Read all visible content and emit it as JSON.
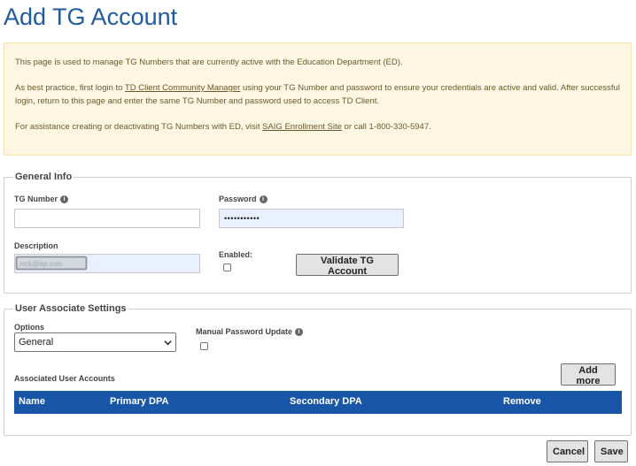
{
  "page": {
    "title": "Add TG Account"
  },
  "notice": {
    "p1": "This page is used to manage TG Numbers that are currently active with the Education Department (ED).",
    "p2_pre": "As best practice, first login to ",
    "p2_link": "TD Client Community Manager",
    "p2_post": " using your TG Number and password to ensure your credentials are active and valid. After successful login, return to this page and enter the same TG Number and password used to access TD Client.",
    "p3_pre": "For assistance creating or deactivating TG Numbers with ED, visit ",
    "p3_link": "SAIG Enrollment Site",
    "p3_post": " or call 1-800-330-5947."
  },
  "general": {
    "legend": "General Info",
    "tg_number_label": "TG Number",
    "tg_number_value": "",
    "password_label": "Password",
    "password_value": "•••••••••••",
    "description_label": "Description",
    "description_value": "nick@ep.com",
    "enabled_label": "Enabled:",
    "validate_label": "Validate TG Account"
  },
  "user_assoc": {
    "legend": "User Associate Settings",
    "options_label": "Options",
    "options_selected": "General",
    "manual_pw_label": "Manual Password Update",
    "assoc_label": "Associated User Accounts",
    "add_more_label": "Add more",
    "columns": [
      "Name",
      "Primary DPA",
      "Secondary DPA",
      "Remove"
    ]
  },
  "footer": {
    "cancel_label": "Cancel",
    "save_label": "Save"
  },
  "colors": {
    "title": "#1f5b9e",
    "header_bar": "#1a56a8",
    "notice_bg": "#fcf6e2"
  },
  "icons": {
    "info": "info-icon",
    "chevron": "chevron-down-icon"
  }
}
